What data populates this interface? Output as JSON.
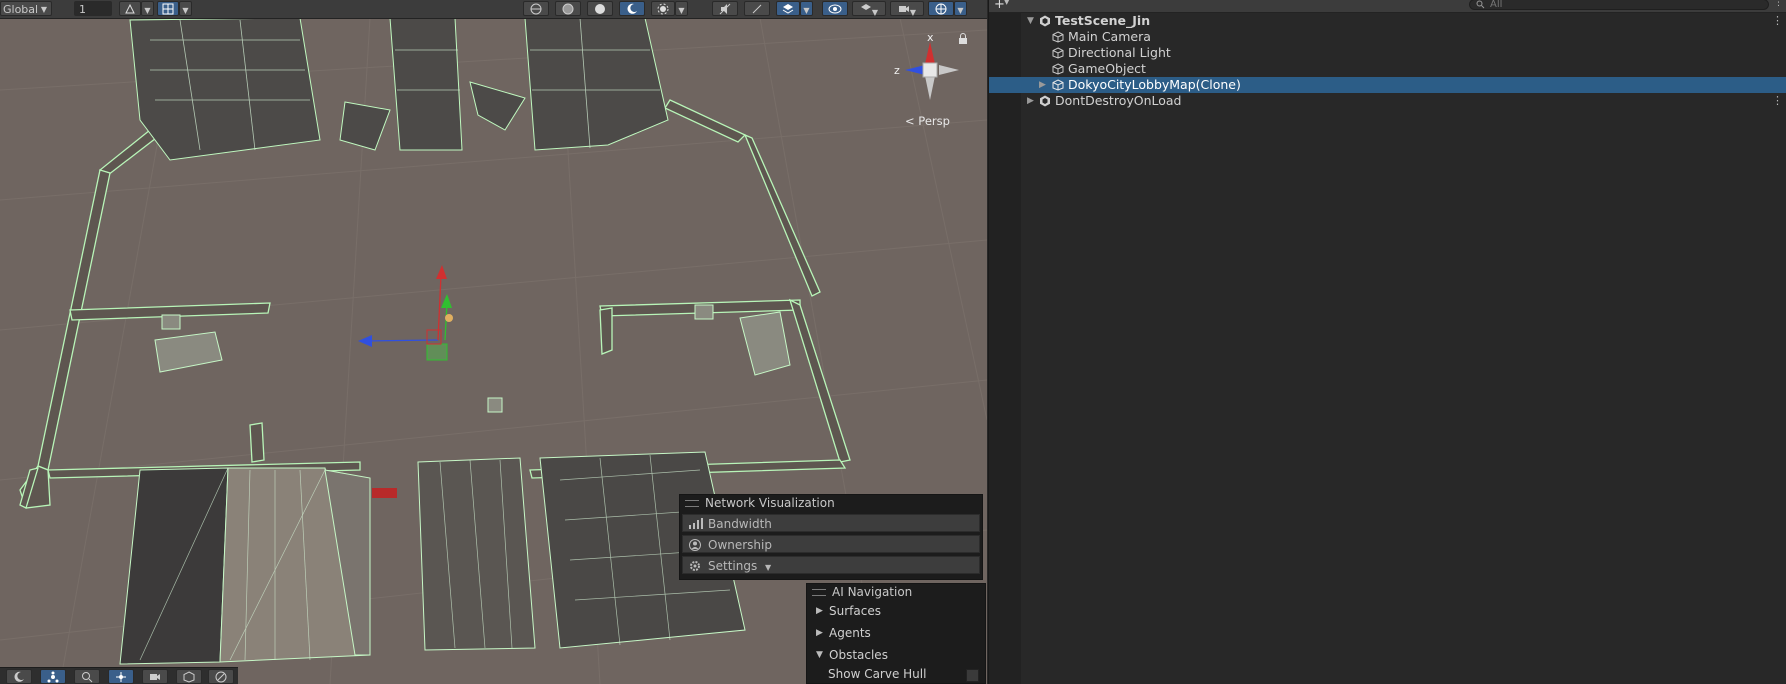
{
  "scene_view": {
    "toolbar": {
      "pivot_label": "Global",
      "grid_value": "1"
    },
    "orientation_gizmo": {
      "axis_x": "x",
      "axis_z": "z",
      "projection_label": "< Persp"
    },
    "overlays": {
      "network_visualization": {
        "title": "Network Visualization",
        "items": [
          "Bandwidth",
          "Ownership",
          "Settings"
        ]
      },
      "ai_navigation": {
        "title": "AI Navigation",
        "items": [
          "Surfaces",
          "Agents",
          "Obstacles"
        ],
        "option_label": "Show Carve Hull"
      }
    }
  },
  "hierarchy": {
    "search_placeholder": "All",
    "rows": [
      {
        "label": "TestScene_Jin",
        "type": "scene"
      },
      {
        "label": "Main Camera",
        "type": "gameobject"
      },
      {
        "label": "Directional Light",
        "type": "gameobject"
      },
      {
        "label": "GameObject",
        "type": "gameobject"
      },
      {
        "label": "DokyoCityLobbyMap(Clone)",
        "type": "gameobject",
        "selected": true
      },
      {
        "label": "DontDestroyOnLoad",
        "type": "scene"
      }
    ]
  },
  "colors": {
    "selection": "#2c5d87",
    "wire_outline": "#b8f5b8",
    "gizmo_x": "#d03030",
    "gizmo_y": "#30c030",
    "gizmo_z": "#3050e0"
  }
}
